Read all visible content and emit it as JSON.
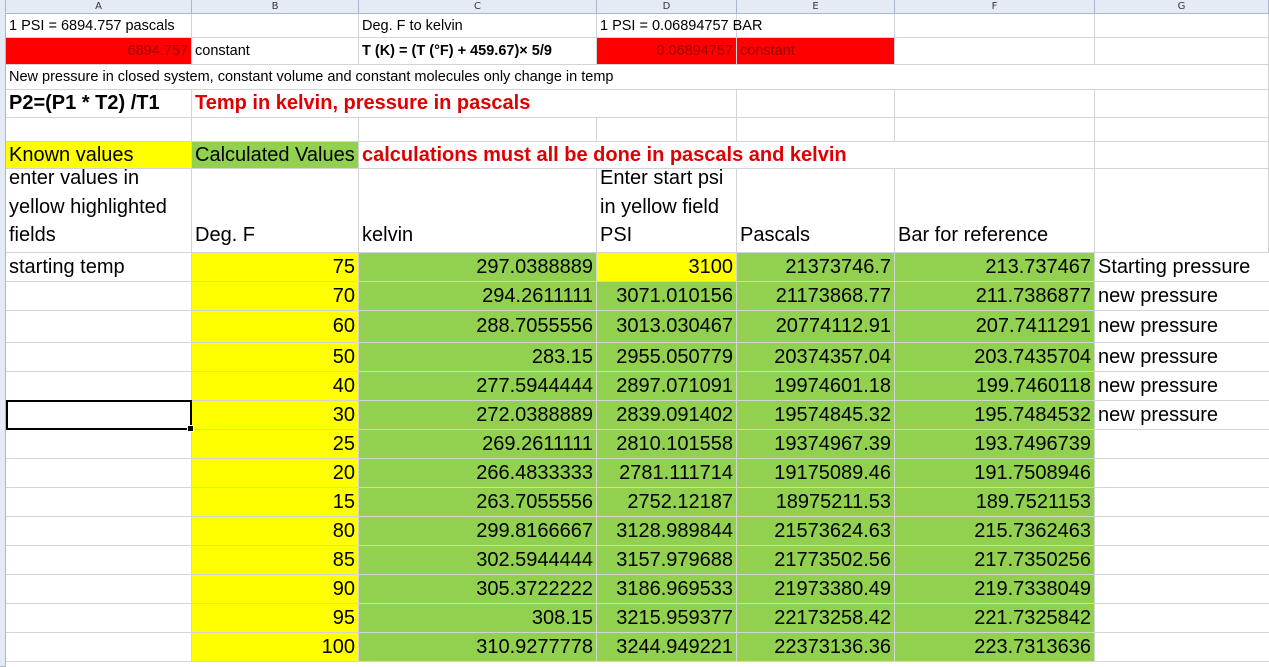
{
  "columns": [
    "A",
    "B",
    "C",
    "D",
    "E",
    "F",
    "G"
  ],
  "row1": {
    "a": "1 PSI = 6894.757 pascals",
    "c": "Deg. F to kelvin",
    "d": "1 PSI = 0.06894757  BAR"
  },
  "row2": {
    "a": "6894.757",
    "b": "constant",
    "c_formula": "T (K) = (T (°F) + 459.67)× 5/9",
    "d": "0.06894757",
    "e": "constant"
  },
  "row3": {
    "a": "New pressure in closed system, constant volume and constant molecules only change in temp"
  },
  "row4": {
    "a": "P2=(P1 * T2) /T1",
    "b": "Temp in kelvin, pressure in pascals"
  },
  "row6": {
    "a": "Known values",
    "b": "Calculated Values",
    "c": "calculations must all be done in pascals and kelvin"
  },
  "row7": {
    "a": "enter values in yellow highlighted fields",
    "b": "Deg. F",
    "c": "kelvin",
    "d": "Enter start psi in yellow field PSI",
    "e": "Pascals",
    "f": "Bar for reference"
  },
  "data_rows": [
    {
      "a": "starting temp",
      "degf": "75",
      "kelvin": "297.0388889",
      "psi": "3100",
      "pascals": "21373746.7",
      "bar": "213.737467",
      "note": "Starting pressure"
    },
    {
      "a": "",
      "degf": "70",
      "kelvin": "294.2611111",
      "psi": "3071.010156",
      "pascals": "21173868.77",
      "bar": "211.7386877",
      "note": "new pressure"
    },
    {
      "a": "",
      "degf": "60",
      "kelvin": "288.7055556",
      "psi": "3013.030467",
      "pascals": "20774112.91",
      "bar": "207.7411291",
      "note": "new pressure"
    },
    {
      "a": "",
      "degf": "50",
      "kelvin": "283.15",
      "psi": "2955.050779",
      "pascals": "20374357.04",
      "bar": "203.7435704",
      "note": "new pressure"
    },
    {
      "a": "",
      "degf": "40",
      "kelvin": "277.5944444",
      "psi": "2897.071091",
      "pascals": "19974601.18",
      "bar": "199.7460118",
      "note": "new pressure"
    },
    {
      "a": "",
      "degf": "30",
      "kelvin": "272.0388889",
      "psi": "2839.091402",
      "pascals": "19574845.32",
      "bar": "195.7484532",
      "note": "new pressure"
    },
    {
      "a": "",
      "degf": "25",
      "kelvin": "269.2611111",
      "psi": "2810.101558",
      "pascals": "19374967.39",
      "bar": "193.7496739",
      "note": ""
    },
    {
      "a": "",
      "degf": "20",
      "kelvin": "266.4833333",
      "psi": "2781.111714",
      "pascals": "19175089.46",
      "bar": "191.7508946",
      "note": ""
    },
    {
      "a": "",
      "degf": "15",
      "kelvin": "263.7055556",
      "psi": "2752.12187",
      "pascals": "18975211.53",
      "bar": "189.7521153",
      "note": ""
    },
    {
      "a": "",
      "degf": "80",
      "kelvin": "299.8166667",
      "psi": "3128.989844",
      "pascals": "21573624.63",
      "bar": "215.7362463",
      "note": ""
    },
    {
      "a": "",
      "degf": "85",
      "kelvin": "302.5944444",
      "psi": "3157.979688",
      "pascals": "21773502.56",
      "bar": "217.7350256",
      "note": ""
    },
    {
      "a": "",
      "degf": "90",
      "kelvin": "305.3722222",
      "psi": "3186.969533",
      "pascals": "21973380.49",
      "bar": "219.7338049",
      "note": ""
    },
    {
      "a": "",
      "degf": "95",
      "kelvin": "308.15",
      "psi": "3215.959377",
      "pascals": "22173258.42",
      "bar": "221.7325842",
      "note": ""
    },
    {
      "a": "",
      "degf": "100",
      "kelvin": "310.9277778",
      "psi": "3244.949221",
      "pascals": "22373136.36",
      "bar": "223.7313636",
      "note": ""
    }
  ],
  "colors": {
    "yellow": "#ffff00",
    "green": "#92d050",
    "red": "#ff0000",
    "red_text": "#e00000",
    "header_bg": "#e4ebf5"
  }
}
